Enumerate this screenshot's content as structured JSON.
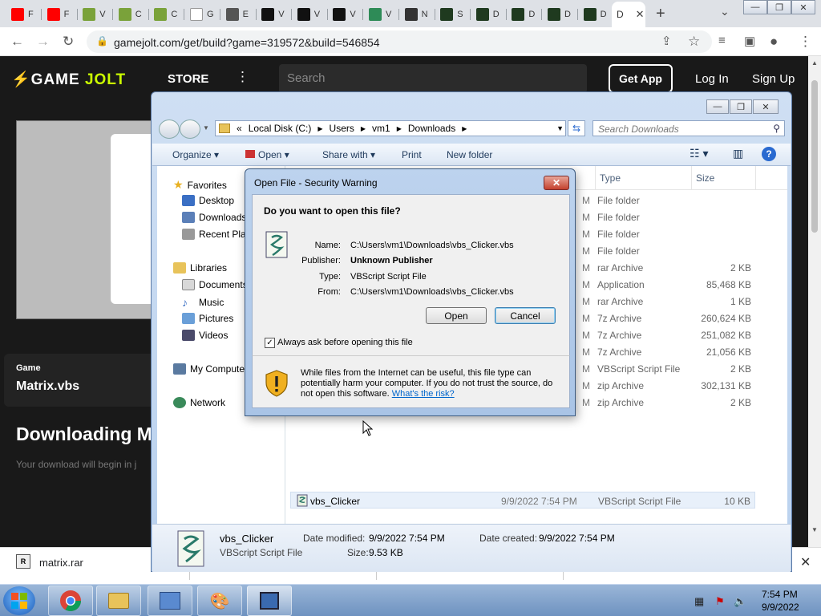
{
  "browser": {
    "tabs": [
      {
        "title": "F",
        "color": "#ff0000"
      },
      {
        "title": "F",
        "color": "#ff0000"
      },
      {
        "title": "V",
        "color": "#7aa23a"
      },
      {
        "title": "C",
        "color": "#7aa23a"
      },
      {
        "title": "C",
        "color": "#7aa23a"
      },
      {
        "title": "G",
        "color": "#ffffff"
      },
      {
        "title": "E",
        "color": "#555555"
      },
      {
        "title": "V",
        "color": "#111111"
      },
      {
        "title": "V",
        "color": "#111111"
      },
      {
        "title": "V",
        "color": "#111111"
      },
      {
        "title": "V",
        "color": "#2e8b57"
      },
      {
        "title": "N",
        "color": "#333333"
      },
      {
        "title": "S",
        "color": "#1f3a1f"
      },
      {
        "title": "D",
        "color": "#1f3a1f"
      },
      {
        "title": "D",
        "color": "#1f3a1f"
      },
      {
        "title": "D",
        "color": "#1f3a1f"
      },
      {
        "title": "D",
        "color": "#1f3a1f"
      }
    ],
    "active_tab": {
      "title": "D",
      "close": "✕"
    },
    "new_tab": "+",
    "tab_search": "⌄",
    "url": "gamejolt.com/get/build?game=319572&build=546854"
  },
  "site": {
    "logo_left": "GAME",
    "logo_right": "JOLT",
    "store": "STORE",
    "search_placeholder": "Search",
    "get_app": "Get App",
    "login": "Log In",
    "signup": "Sign Up",
    "game_label": "Game",
    "game_name": "Matrix.vbs",
    "downloading": "Downloading M",
    "download_begin": "Your download will begin in j"
  },
  "download_bar": {
    "icon": "R",
    "filename": "matrix.rar",
    "close": "✕"
  },
  "explorer": {
    "address": [
      "«",
      "Local Disk (C:)",
      "Users",
      "vm1",
      "Downloads"
    ],
    "search_placeholder": "Search Downloads",
    "commands": {
      "organize": "Organize ▾",
      "open": "Open ▾",
      "share": "Share with ▾",
      "print": "Print",
      "new_folder": "New folder"
    },
    "nav": {
      "favorites": "Favorites",
      "desktop": "Desktop",
      "downloads": "Downloads",
      "recent": "Recent Plac",
      "libraries": "Libraries",
      "documents": "Documents",
      "music": "Music",
      "pictures": "Pictures",
      "videos": "Videos",
      "computer": "My Compute",
      "network": "Network"
    },
    "columns": {
      "type": "Type",
      "size": "Size"
    },
    "rows": [
      {
        "type": "File folder",
        "size": ""
      },
      {
        "type": "File folder",
        "size": ""
      },
      {
        "type": "File folder",
        "size": ""
      },
      {
        "type": "File folder",
        "size": ""
      },
      {
        "type": "rar Archive",
        "size": "2 KB"
      },
      {
        "type": "Application",
        "size": "85,468 KB"
      },
      {
        "type": "rar Archive",
        "size": "1 KB"
      },
      {
        "type": "7z Archive",
        "size": "260,624 KB"
      },
      {
        "type": "7z Archive",
        "size": "251,082 KB"
      },
      {
        "type": "7z Archive",
        "size": "21,056 KB"
      },
      {
        "type": "VBScript Script File",
        "size": "2 KB"
      },
      {
        "type": "zip Archive",
        "size": "302,131 KB"
      },
      {
        "type": "zip Archive",
        "size": "2 KB"
      }
    ],
    "row_m": "M",
    "selected_row": {
      "name": "vbs_Clicker",
      "date": "9/9/2022 7:54 PM",
      "type": "VBScript Script File",
      "size": "10 KB"
    },
    "details": {
      "name": "vbs_Clicker",
      "kind": "VBScript Script File",
      "modified_label": "Date modified:",
      "modified": "9/9/2022 7:54 PM",
      "created_label": "Date created:",
      "created": "9/9/2022 7:54 PM",
      "size_label": "Size:",
      "size": "9.53 KB"
    }
  },
  "dialog": {
    "title": "Open File - Security Warning",
    "question": "Do you want to open this file?",
    "name_label": "Name:",
    "name": "C:\\Users\\vm1\\Downloads\\vbs_Clicker.vbs",
    "publisher_label": "Publisher:",
    "publisher": "Unknown Publisher",
    "type_label": "Type:",
    "type": "VBScript Script File",
    "from_label": "From:",
    "from": "C:\\Users\\vm1\\Downloads\\vbs_Clicker.vbs",
    "open_button": "Open",
    "cancel_button": "Cancel",
    "checkbox_label": "Always ask before opening this file",
    "warning_text": "While files from the Internet can be useful, this file type can potentially harm your computer. If you do not trust the source, do not open this software.",
    "risk_link": "What's the risk?"
  },
  "taskbar": {
    "time": "7:54 PM",
    "date": "9/9/2022"
  },
  "colors": {
    "gamejolt_accent": "#ccff00",
    "dialog_close": "#c4412e",
    "link": "#0066cc"
  }
}
